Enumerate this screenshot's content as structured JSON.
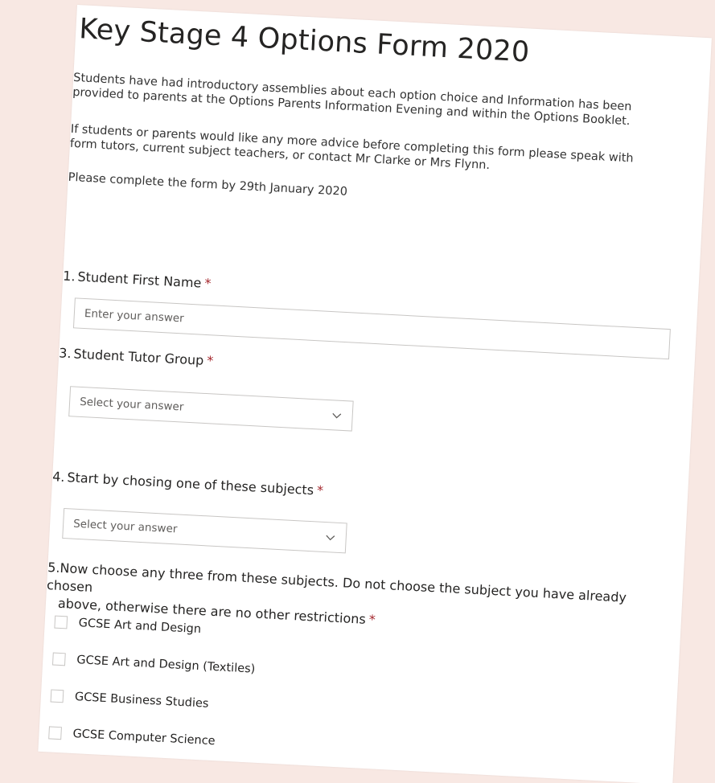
{
  "form": {
    "title": "Key Stage 4 Options Form 2020",
    "description": [
      "Students have had introductory assemblies about each option choice and Information has been provided to parents at the Options Parents Information Evening and within the Options Booklet.",
      "If students or parents would like any more advice before completing this form please speak with form tutors, current subject teachers, or contact Mr Clarke or Mrs Flynn.",
      "Please complete the form by 29th January 2020"
    ]
  },
  "questions": {
    "q1": {
      "number": "1.",
      "label": "Student First Name",
      "required_mark": "*",
      "placeholder": "Enter your answer",
      "value": ""
    },
    "q3": {
      "number": "3.",
      "label": "Student Tutor Group",
      "required_mark": "*",
      "selected": "Select your answer"
    },
    "q4": {
      "number": "4.",
      "label": "Start by chosing one of these subjects",
      "required_mark": "*",
      "selected": "Select your answer"
    },
    "q5": {
      "number": "5.",
      "label_line1": "Now choose any three from these subjects. Do not choose the subject you have already chosen",
      "label_line2": "above, otherwise there are no other restrictions",
      "required_mark": "*",
      "options": [
        "GCSE Art and Design",
        "GCSE Art and Design (Textiles)",
        "GCSE Business Studies",
        "GCSE Computer Science"
      ]
    }
  },
  "icons": {
    "dropdown": "chevron-down-icon"
  },
  "colors": {
    "background": "#f8e8e3",
    "card": "#ffffff",
    "required": "#a4262c",
    "border": "#c8c6c4"
  }
}
